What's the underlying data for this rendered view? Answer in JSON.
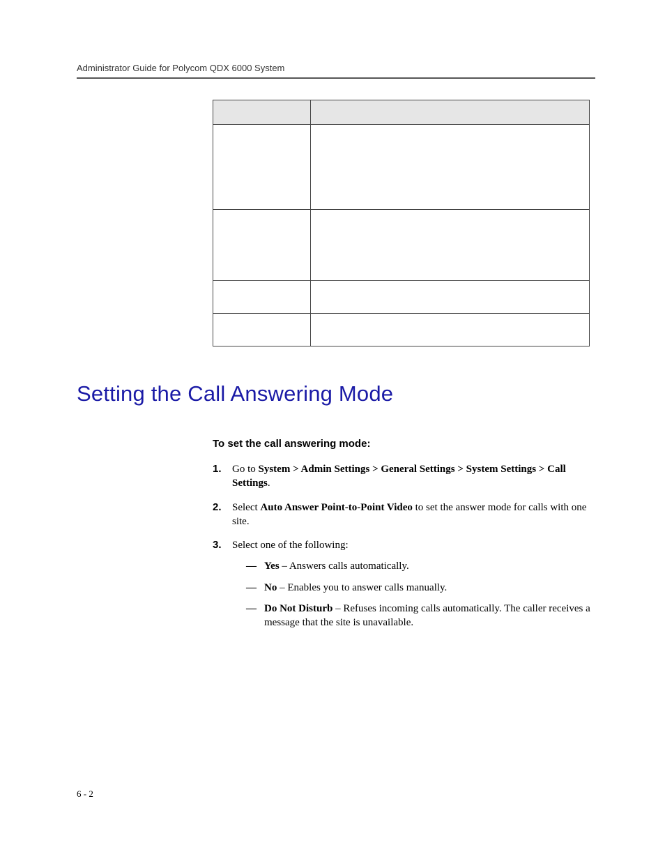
{
  "header": {
    "title": "Administrator Guide for Polycom QDX 6000 System"
  },
  "table": {
    "headers": [
      "",
      ""
    ],
    "rows": [
      [
        "",
        ""
      ],
      [
        "",
        ""
      ],
      [
        "",
        ""
      ],
      [
        "",
        ""
      ]
    ]
  },
  "section": {
    "title": "Setting the Call Answering Mode"
  },
  "instructions": {
    "lead": "To set the call answering mode:",
    "step1_pre": "Go to ",
    "step1_bold": "System > Admin Settings > General Settings > System Settings > Call Settings",
    "step1_post": ".",
    "step2_pre": "Select ",
    "step2_bold": "Auto Answer Point-to-Point Video",
    "step2_post": " to set the answer mode for calls with one site.",
    "step3": "Select one of the following:",
    "opt1_bold": "Yes",
    "opt1_post": " – Answers calls automatically.",
    "opt2_bold": "No",
    "opt2_post": " – Enables you to answer calls manually.",
    "opt3_bold": "Do Not Disturb",
    "opt3_post": " – Refuses incoming calls automatically. The caller receives a message that the site is unavailable."
  },
  "page_number": "6 - 2"
}
